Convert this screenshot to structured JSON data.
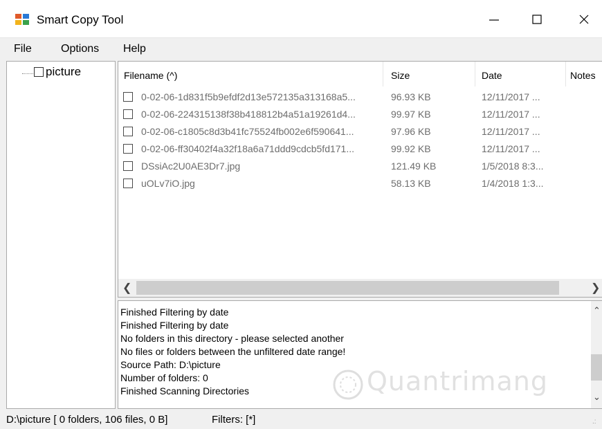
{
  "window": {
    "title": "Smart Copy Tool",
    "minimize_glyph": "—",
    "maximize_glyph": "☐",
    "close_glyph": "✕"
  },
  "menu": [
    "File",
    "Options",
    "Help"
  ],
  "tree": {
    "items": [
      {
        "label": "picture",
        "checked": false
      }
    ]
  },
  "file_list": {
    "columns": [
      "Filename (^)",
      "Size",
      "Date",
      "Notes"
    ],
    "rows": [
      {
        "filename": "0-02-06-1d831f5b9efdf2d13e572135a313168a5...",
        "size": "96.93 KB",
        "date": "12/11/2017 ..."
      },
      {
        "filename": "0-02-06-224315138f38b418812b4a51a19261d4...",
        "size": "99.97 KB",
        "date": "12/11/2017 ..."
      },
      {
        "filename": "0-02-06-c1805c8d3b41fc75524fb002e6f590641...",
        "size": "97.96 KB",
        "date": "12/11/2017 ..."
      },
      {
        "filename": "0-02-06-ff30402f4a32f18a6a71ddd9cdcb5fd171...",
        "size": "99.92 KB",
        "date": "12/11/2017 ..."
      },
      {
        "filename": "DSsiAc2U0AE3Dr7.jpg",
        "size": "121.49 KB",
        "date": "1/5/2018 8:3..."
      },
      {
        "filename": "uOLv7iO.jpg",
        "size": "58.13 KB",
        "date": "1/4/2018 1:3..."
      }
    ]
  },
  "log": {
    "lines": [
      "Finished Filtering by date",
      "Finished Filtering by date",
      "No folders in this directory - please selected another",
      "No files or folders between the unfiltered date range!",
      "Source Path: D:\\picture",
      "Number of folders: 0",
      "Finished Scanning Directories"
    ]
  },
  "status": {
    "path_info": "D:\\picture [ 0 folders, 106 files, 0 B]",
    "filters": "Filters: [*]"
  },
  "watermark": {
    "text": "Quantrimang"
  },
  "colors": {
    "accent_blue": "#1e6fd9",
    "border": "#a9a9a9",
    "grey_text": "#6d6d6d"
  }
}
